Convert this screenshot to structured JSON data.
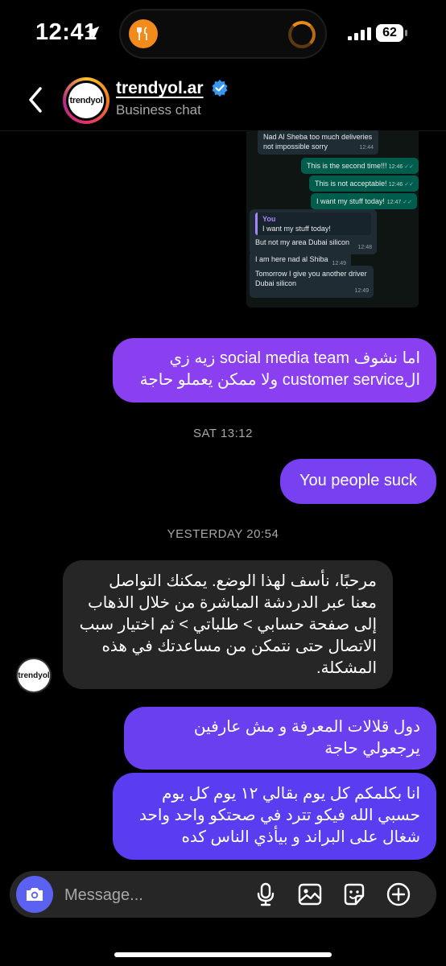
{
  "status_bar": {
    "time": "12:41",
    "battery": "62"
  },
  "header": {
    "contact_name": "trendyol.ar",
    "subtitle": "Business chat",
    "avatar_text": "trendyol"
  },
  "shared_screenshot": {
    "messages": [
      {
        "dir": "in",
        "text": "Nad Al Sheba too much deliveries not impossible sorry",
        "time": "12:44"
      },
      {
        "dir": "out",
        "text": "This is the second time!!!",
        "time": "12:46"
      },
      {
        "dir": "out",
        "text": "This is not acceptable!",
        "time": "12:46"
      },
      {
        "dir": "out",
        "text": "I want my stuff today!",
        "time": "12:47"
      },
      {
        "dir": "in",
        "quote_author": "You",
        "quote_text": "I want my stuff today!",
        "text": "But not my area Dubai silicon",
        "time": "12:48"
      },
      {
        "dir": "in",
        "text": "I am here nad al Shiba",
        "time": "12:49"
      },
      {
        "dir": "in",
        "text": "Tomorrow I give you another driver Dubai silicon",
        "time": "12:49"
      }
    ]
  },
  "messages": {
    "m1_line1": "اما نشوف social media team زيه زي",
    "m1_line2": "الcustomer service ولا ممكن يعملو حاجة",
    "sep1": "SAT 13:12",
    "m2": "You people suck",
    "sep2": "YESTERDAY 20:54",
    "m3": "مرحبًا، نأسف لهذا الوضع. يمكنك التواصل معنا عبر الدردشة المباشرة من خلال الذهاب إلى صفحة حسابي > طلباتي > ثم اختيار سبب الاتصال حتى نتمكن من مساعدتك في هذه المشكلة.",
    "m4": "دول قلالات المعرفة و مش عارفين يرجعولي حاجة",
    "m5": "انا بكلمكم كل يوم بقالي ١٢ يوم كل يوم حسبي الله فيكو تترد في صحتكو واحد واحد شغال على البراند و بيأذي الناس كده"
  },
  "composer": {
    "placeholder": "Message..."
  },
  "colors": {
    "bubble_top": "#8a3ff0",
    "bubble_bottom": "#5a3df0",
    "camera": "#5b62f2",
    "incoming": "#262626"
  }
}
